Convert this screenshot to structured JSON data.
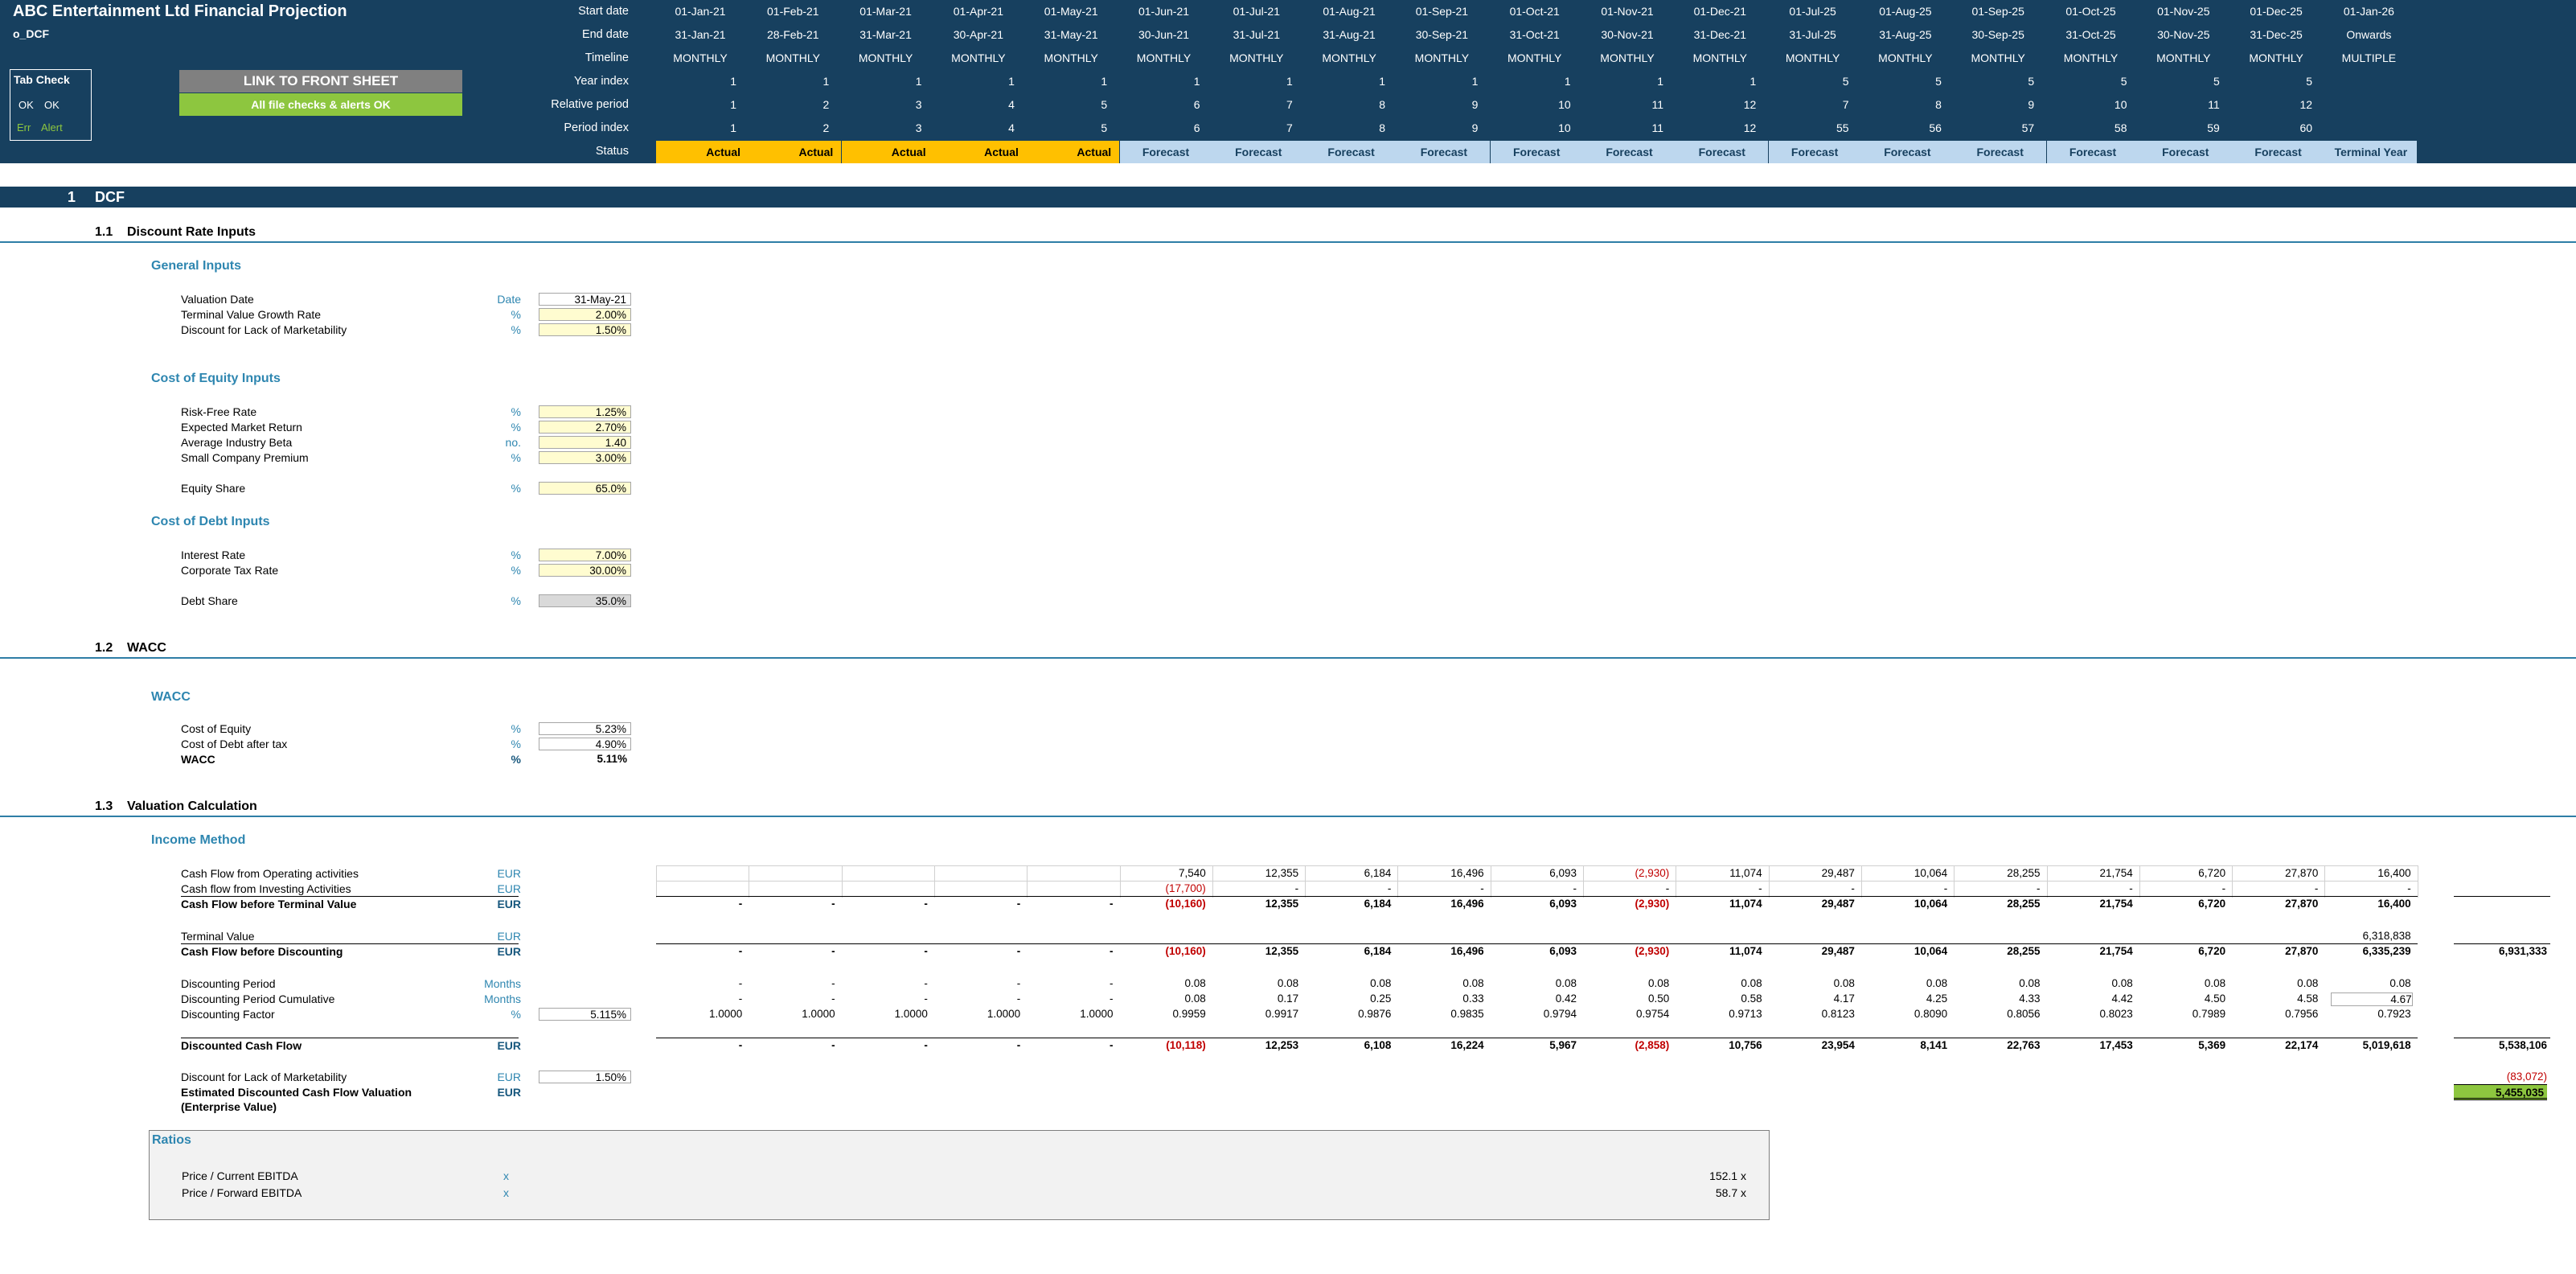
{
  "header": {
    "title": "ABC Entertainment Ltd Financial Projection",
    "sheet_name": "o_DCF",
    "tab_check": {
      "title": "Tab Check",
      "ok1": "OK",
      "ok2": "OK",
      "err": "Err",
      "alert": "Alert"
    },
    "link_button": "LINK TO FRONT SHEET",
    "checks_ok": "All file checks & alerts OK",
    "row_labels": {
      "start": "Start date",
      "end": "End date",
      "timeline": "Timeline",
      "year": "Year index",
      "relative": "Relative period",
      "period": "Period index",
      "status": "Status"
    },
    "columns": [
      {
        "start": "01-Jan-21",
        "end": "31-Jan-21",
        "timeline": "MONTHLY",
        "year": "1",
        "relative": "1",
        "period": "1",
        "status": "Actual"
      },
      {
        "start": "01-Feb-21",
        "end": "28-Feb-21",
        "timeline": "MONTHLY",
        "year": "1",
        "relative": "2",
        "period": "2",
        "status": "Actual"
      },
      {
        "start": "01-Mar-21",
        "end": "31-Mar-21",
        "timeline": "MONTHLY",
        "year": "1",
        "relative": "3",
        "period": "3",
        "status": "Actual"
      },
      {
        "start": "01-Apr-21",
        "end": "30-Apr-21",
        "timeline": "MONTHLY",
        "year": "1",
        "relative": "4",
        "period": "4",
        "status": "Actual"
      },
      {
        "start": "01-May-21",
        "end": "31-May-21",
        "timeline": "MONTHLY",
        "year": "1",
        "relative": "5",
        "period": "5",
        "status": "Actual"
      },
      {
        "start": "01-Jun-21",
        "end": "30-Jun-21",
        "timeline": "MONTHLY",
        "year": "1",
        "relative": "6",
        "period": "6",
        "status": "Forecast"
      },
      {
        "start": "01-Jul-21",
        "end": "31-Jul-21",
        "timeline": "MONTHLY",
        "year": "1",
        "relative": "7",
        "period": "7",
        "status": "Forecast"
      },
      {
        "start": "01-Aug-21",
        "end": "31-Aug-21",
        "timeline": "MONTHLY",
        "year": "1",
        "relative": "8",
        "period": "8",
        "status": "Forecast"
      },
      {
        "start": "01-Sep-21",
        "end": "30-Sep-21",
        "timeline": "MONTHLY",
        "year": "1",
        "relative": "9",
        "period": "9",
        "status": "Forecast"
      },
      {
        "start": "01-Oct-21",
        "end": "31-Oct-21",
        "timeline": "MONTHLY",
        "year": "1",
        "relative": "10",
        "period": "10",
        "status": "Forecast"
      },
      {
        "start": "01-Nov-21",
        "end": "30-Nov-21",
        "timeline": "MONTHLY",
        "year": "1",
        "relative": "11",
        "period": "11",
        "status": "Forecast"
      },
      {
        "start": "01-Dec-21",
        "end": "31-Dec-21",
        "timeline": "MONTHLY",
        "year": "1",
        "relative": "12",
        "period": "12",
        "status": "Forecast"
      },
      {
        "start": "01-Jul-25",
        "end": "31-Jul-25",
        "timeline": "MONTHLY",
        "year": "5",
        "relative": "7",
        "period": "55",
        "status": "Forecast"
      },
      {
        "start": "01-Aug-25",
        "end": "31-Aug-25",
        "timeline": "MONTHLY",
        "year": "5",
        "relative": "8",
        "period": "56",
        "status": "Forecast"
      },
      {
        "start": "01-Sep-25",
        "end": "30-Sep-25",
        "timeline": "MONTHLY",
        "year": "5",
        "relative": "9",
        "period": "57",
        "status": "Forecast"
      },
      {
        "start": "01-Oct-25",
        "end": "31-Oct-25",
        "timeline": "MONTHLY",
        "year": "5",
        "relative": "10",
        "period": "58",
        "status": "Forecast"
      },
      {
        "start": "01-Nov-25",
        "end": "30-Nov-25",
        "timeline": "MONTHLY",
        "year": "5",
        "relative": "11",
        "period": "59",
        "status": "Forecast"
      },
      {
        "start": "01-Dec-25",
        "end": "31-Dec-25",
        "timeline": "MONTHLY",
        "year": "5",
        "relative": "12",
        "period": "60",
        "status": "Forecast"
      },
      {
        "start": "01-Jan-26",
        "end": "Onwards",
        "timeline": "MULTIPLE",
        "year": "",
        "relative": "",
        "period": "",
        "status": "Terminal Year"
      }
    ]
  },
  "section": {
    "number": "1",
    "title": "DCF"
  },
  "sub1": {
    "number": "1.1",
    "title": "Discount Rate Inputs"
  },
  "sub2": {
    "number": "1.2",
    "title": "WACC"
  },
  "sub3": {
    "number": "1.3",
    "title": "Valuation Calculation"
  },
  "general": {
    "title": "General Inputs",
    "rows": [
      {
        "label": "Valuation Date",
        "unit": "Date",
        "value": "31-May-21"
      },
      {
        "label": "Terminal Value Growth Rate",
        "unit": "%",
        "value": "2.00%"
      },
      {
        "label": "Discount for Lack of Marketability",
        "unit": "%",
        "value": "1.50%"
      }
    ]
  },
  "equity": {
    "title": "Cost of Equity Inputs",
    "rows": [
      {
        "label": "Risk-Free Rate",
        "unit": "%",
        "value": "1.25%"
      },
      {
        "label": "Expected Market Return",
        "unit": "%",
        "value": "2.70%"
      },
      {
        "label": "Average Industry Beta",
        "unit": "no.",
        "value": "1.40"
      },
      {
        "label": "Small Company Premium",
        "unit": "%",
        "value": "3.00%"
      }
    ],
    "share": {
      "label": "Equity Share",
      "unit": "%",
      "value": "65.0%"
    }
  },
  "debt": {
    "title": "Cost of Debt Inputs",
    "rows": [
      {
        "label": "Interest Rate",
        "unit": "%",
        "value": "7.00%"
      },
      {
        "label": "Corporate Tax Rate",
        "unit": "%",
        "value": "30.00%"
      }
    ],
    "share": {
      "label": "Debt Share",
      "unit": "%",
      "value": "35.0%"
    }
  },
  "wacc": {
    "title": "WACC",
    "rows": [
      {
        "label": "Cost of Equity",
        "unit": "%",
        "value": "5.23%"
      },
      {
        "label": "Cost of Debt after tax",
        "unit": "%",
        "value": "4.90%"
      },
      {
        "label": "WACC",
        "unit": "%",
        "value": "5.11%"
      }
    ]
  },
  "income": {
    "title": "Income Method",
    "rows": [
      {
        "label": "Cash Flow from Operating activities",
        "unit": "EUR",
        "bold": false,
        "values": [
          "",
          "",
          "",
          "",
          "",
          "7,540",
          "12,355",
          "6,184",
          "16,496",
          "6,093",
          "(2,930)",
          "11,074",
          "29,487",
          "10,064",
          "28,255",
          "21,754",
          "6,720",
          "27,870",
          "16,400"
        ],
        "extra": ""
      },
      {
        "label": "Cash flow from Investing Activities",
        "unit": "EUR",
        "bold": false,
        "values": [
          "",
          "",
          "",
          "",
          "",
          "(17,700)",
          "-",
          "-",
          "-",
          "-",
          "-",
          "-",
          "-",
          "-",
          "-",
          "-",
          "-",
          "-",
          "-"
        ],
        "extra": ""
      },
      {
        "label": "Cash Flow before Terminal Value",
        "unit": "EUR",
        "bold": true,
        "values": [
          "-",
          "-",
          "-",
          "-",
          "-",
          "(10,160)",
          "12,355",
          "6,184",
          "16,496",
          "6,093",
          "(2,930)",
          "11,074",
          "29,487",
          "10,064",
          "28,255",
          "21,754",
          "6,720",
          "27,870",
          "16,400"
        ],
        "extra": ""
      },
      {
        "label": "Terminal Value",
        "unit": "EUR",
        "bold": false,
        "values": [
          "",
          "",
          "",
          "",
          "",
          "",
          "",
          "",
          "",
          "",
          "",
          "",
          "",
          "",
          "",
          "",
          "",
          "",
          "6,318,838"
        ],
        "extra": ""
      },
      {
        "label": "Cash Flow before Discounting",
        "unit": "EUR",
        "bold": true,
        "values": [
          "-",
          "-",
          "-",
          "-",
          "-",
          "(10,160)",
          "12,355",
          "6,184",
          "16,496",
          "6,093",
          "(2,930)",
          "11,074",
          "29,487",
          "10,064",
          "28,255",
          "21,754",
          "6,720",
          "27,870",
          "6,335,239"
        ],
        "extra": "6,931,333"
      },
      {
        "label": "Discounting Period",
        "unit": "Months",
        "bold": false,
        "values": [
          "-",
          "-",
          "-",
          "-",
          "-",
          "0.08",
          "0.08",
          "0.08",
          "0.08",
          "0.08",
          "0.08",
          "0.08",
          "0.08",
          "0.08",
          "0.08",
          "0.08",
          "0.08",
          "0.08",
          "0.08"
        ],
        "extra": ""
      },
      {
        "label": "Discounting Period Cumulative",
        "unit": "Months",
        "bold": false,
        "values": [
          "-",
          "-",
          "-",
          "-",
          "-",
          "0.08",
          "0.17",
          "0.25",
          "0.33",
          "0.42",
          "0.50",
          "0.58",
          "4.17",
          "4.25",
          "4.33",
          "4.42",
          "4.50",
          "4.58",
          "4.67"
        ],
        "extra": ""
      },
      {
        "label": "Discounting Factor",
        "unit": "%",
        "bold": false,
        "input": "5.115%",
        "values": [
          "1.0000",
          "1.0000",
          "1.0000",
          "1.0000",
          "1.0000",
          "0.9959",
          "0.9917",
          "0.9876",
          "0.9835",
          "0.9794",
          "0.9754",
          "0.9713",
          "0.8123",
          "0.8090",
          "0.8056",
          "0.8023",
          "0.7989",
          "0.7956",
          "0.7923"
        ],
        "extra": ""
      },
      {
        "label": "Discounted Cash Flow",
        "unit": "EUR",
        "bold": true,
        "values": [
          "-",
          "-",
          "-",
          "-",
          "-",
          "(10,118)",
          "12,253",
          "6,108",
          "16,224",
          "5,967",
          "(2,858)",
          "10,756",
          "23,954",
          "8,141",
          "22,763",
          "17,453",
          "5,369",
          "22,174",
          "5,019,618"
        ],
        "extra": "5,538,106"
      },
      {
        "label": "Discount for Lack of Marketability",
        "unit": "EUR",
        "bold": false,
        "input": "1.50%",
        "values": [
          "",
          "",
          "",
          "",
          "",
          "",
          "",
          "",
          "",
          "",
          "",
          "",
          "",
          "",
          "",
          "",
          "",
          "",
          ""
        ],
        "extra": "(83,072)"
      },
      {
        "label": "Estimated Discounted Cash Flow Valuation",
        "unit": "EUR",
        "bold": true,
        "values": [
          "",
          "",
          "",
          "",
          "",
          "",
          "",
          "",
          "",
          "",
          "",
          "",
          "",
          "",
          "",
          "",
          "",
          "",
          ""
        ],
        "extra": "5,455,035"
      }
    ],
    "ev_label": "(Enterprise Value)"
  },
  "ratios": {
    "title": "Ratios",
    "rows": [
      {
        "label": "Price / Current EBITDA",
        "unit": "x",
        "value": "152.1 x"
      },
      {
        "label": "Price / Forward EBITDA",
        "unit": "x",
        "value": "58.7 x"
      }
    ]
  },
  "colors": {
    "header": "#17405f",
    "actual": "#ffc000",
    "forecast": "#bdd7ee",
    "input": "#fffcd0",
    "ok": "#8dc63f"
  }
}
